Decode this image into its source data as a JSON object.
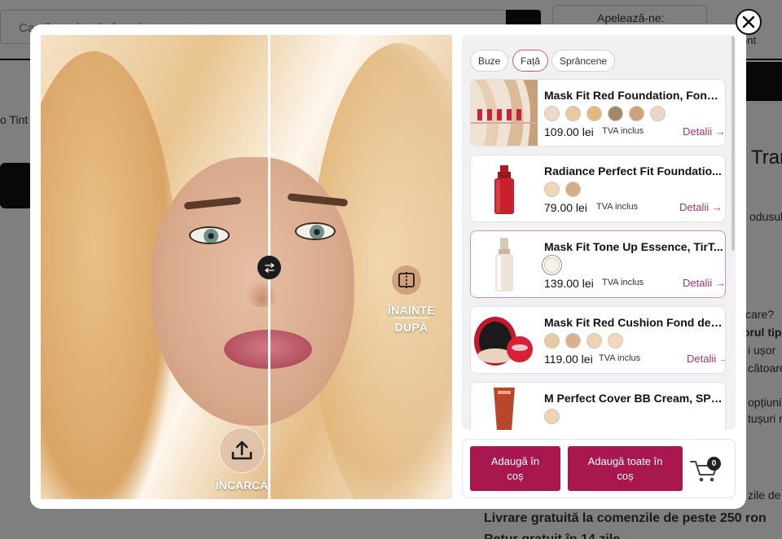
{
  "background": {
    "search_placeholder": "Caută produsele favorite",
    "call_label": "Apelează-ne:",
    "account_label": "ont",
    "breadcrumb": "o Tint",
    "title_fragment": "Tran",
    "text_fragments": [
      "odusul I",
      "icare?",
      "orul tip",
      "i ușor",
      "cătoare",
      "opțiuni",
      "tușuri n",
      "zile de"
    ],
    "bottom_line_1": "Livrare gratuită la comenzile de peste 250 ron",
    "bottom_line_2": "Retur gratuit în 14 zile"
  },
  "modal": {
    "close_icon": "close-icon",
    "divider_icon": "swap-arrows-icon",
    "before_label": "ÎNAINTE",
    "after_label": "DUPĂ",
    "upload_label": "ÎNCARCĂ",
    "upload_icon": "upload-icon",
    "tabs": [
      {
        "label": "Buze",
        "active": false
      },
      {
        "label": "Față",
        "active": true
      },
      {
        "label": "Sprâncene",
        "active": false
      }
    ],
    "products": [
      {
        "name": "Mask Fit Red Foundation, Fond ...",
        "swatches": [
          "#ecd9c9",
          "#e8c9a4",
          "#e2b883",
          "#a3876a",
          "#cda37b",
          "#ead6c8"
        ],
        "price": "109.00 lei",
        "vat": "TVA inclus",
        "details": "Detalii →"
      },
      {
        "name": "Radiance Perfect Fit Foundatio...",
        "swatches": [
          "#eed6bb",
          "#d4ad86"
        ],
        "price": "79.00 lei",
        "vat": "TVA inclus",
        "details": "Detalii →"
      },
      {
        "name": "Mask Fit Tone Up Essence, TirT...",
        "swatches": [
          "#f7f1e5"
        ],
        "price": "139.00 lei",
        "vat": "TVA inclus",
        "details": "Detalii →"
      },
      {
        "name": "Mask Fit Red Cushion Fond de T...",
        "swatches": [
          "#e9c8a4",
          "#d7b290",
          "#ecd3b3",
          "#efd8bd"
        ],
        "price": "119.00 lei",
        "vat": "TVA inclus",
        "details": "Detalii →"
      },
      {
        "name": "M Perfect Cover BB Cream, SPF ...",
        "swatches": [
          "#ecd3b1"
        ],
        "price": "",
        "vat": "",
        "details": ""
      }
    ],
    "add_to_cart": "Adaugă în coș",
    "add_all_to_cart": "Adaugă toate în coș",
    "cart_count": "0",
    "accent_color": "#a8184f"
  }
}
